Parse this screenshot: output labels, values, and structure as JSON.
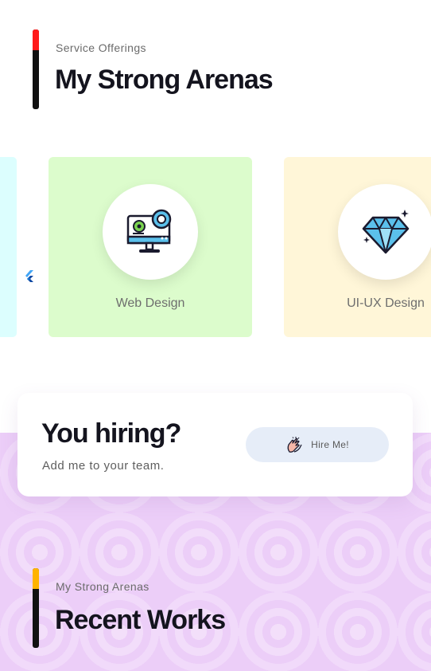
{
  "services_section": {
    "eyebrow": "Service Offerings",
    "title": "My Strong Arenas",
    "accent_color": "#ff1a1a"
  },
  "service_cards": [
    {
      "label": "",
      "icon": "partial-card",
      "bg_color": "#dcfefe"
    },
    {
      "label": "Web Design",
      "icon": "monitor-gears-icon",
      "bg_color": "#dcfccc"
    },
    {
      "label": "UI-UX Design",
      "icon": "diamond-icon",
      "bg_color": "#fff6d8"
    }
  ],
  "hire": {
    "title": "You hiring?",
    "subtitle": "Add me to your team.",
    "button_label": "Hire Me!",
    "button_icon": "clapping-hands-icon"
  },
  "works_section": {
    "eyebrow": "My Strong Arenas",
    "title": "Recent Works",
    "accent_color": "#ffb300"
  }
}
